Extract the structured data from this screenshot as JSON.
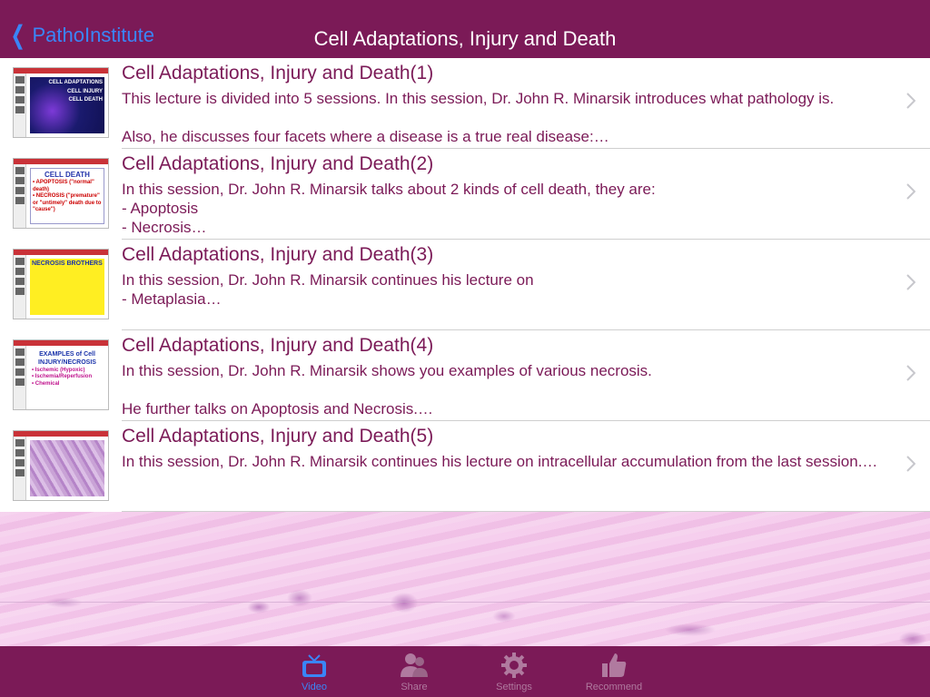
{
  "nav": {
    "back_label": "PathoInstitute",
    "title": "Cell Adaptations, Injury and Death"
  },
  "lectures": [
    {
      "title": "Cell Adaptations, Injury and Death(1)",
      "description": "This lecture is divided into 5 sessions. In this session, Dr. John R. Minarsik introduces what pathology is.\n\nAlso, he discusses four facets where a disease is a true real disease:…",
      "thumb_text": [
        "CELL ADAPTATIONS",
        "CELL INJURY",
        "CELL DEATH"
      ]
    },
    {
      "title": "Cell Adaptations, Injury and Death(2)",
      "description": "In this session, Dr. John R. Minarsik talks about 2 kinds of cell death, they are:\n- Apoptosis\n- Necrosis…",
      "thumb_text": [
        "CELL DEATH",
        "• APOPTOSIS (\"normal\" death)",
        "• NECROSIS (\"premature\" or \"untimely\" death due to \"cause\")"
      ]
    },
    {
      "title": "Cell Adaptations, Injury and Death(3)",
      "description": "In this session, Dr. John R. Minarsik continues his lecture on\n- Metaplasia…",
      "thumb_text": [
        "NECROSIS BROTHERS"
      ]
    },
    {
      "title": "Cell Adaptations, Injury and Death(4)",
      "description": "In this session, Dr. John R. Minarsik shows you examples of various necrosis.\n\nHe further talks on Apoptosis and Necrosis.…",
      "thumb_text": [
        "EXAMPLES of Cell INJURY/NECROSIS",
        "• Ischemic (Hypoxic)",
        "• Ischemia/Reperfusion",
        "• Chemical"
      ]
    },
    {
      "title": "Cell Adaptations, Injury and Death(5)",
      "description": "In this session, Dr. John R. Minarsik continues his lecture on intracellular accumulation from the last session.…",
      "thumb_text": []
    }
  ],
  "tabs": [
    {
      "label": "Video",
      "icon": "tv-icon",
      "active": true
    },
    {
      "label": "Share",
      "icon": "people-icon",
      "active": false
    },
    {
      "label": "Settings",
      "icon": "gear-icon",
      "active": false
    },
    {
      "label": "Recommend",
      "icon": "thumbs-up-icon",
      "active": false
    }
  ],
  "colors": {
    "bar": "#7b1a57",
    "accent": "#3a85f7",
    "text": "#7b1a57"
  }
}
